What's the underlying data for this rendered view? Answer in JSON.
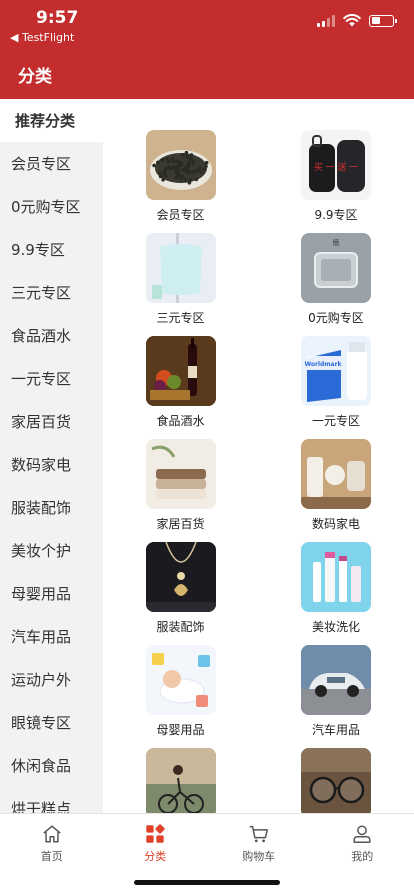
{
  "status": {
    "time": "9:57",
    "back_app": "◀ TestFlight"
  },
  "header": {
    "title": "分类"
  },
  "sidebar": {
    "items": [
      {
        "label": "推荐分类",
        "active": true
      },
      {
        "label": "会员专区"
      },
      {
        "label": "0元购专区"
      },
      {
        "label": "9.9专区"
      },
      {
        "label": "三元专区"
      },
      {
        "label": "食品酒水"
      },
      {
        "label": "一元专区"
      },
      {
        "label": "家居百货"
      },
      {
        "label": "数码家电"
      },
      {
        "label": "服装配饰"
      },
      {
        "label": "美妆个护"
      },
      {
        "label": "母婴用品"
      },
      {
        "label": "汽车用品"
      },
      {
        "label": "运动户外"
      },
      {
        "label": "眼镜专区"
      },
      {
        "label": "休闲食品"
      },
      {
        "label": "烘干糕点"
      }
    ]
  },
  "categories": [
    {
      "label": "会员专区",
      "image": "tea-leaves"
    },
    {
      "label": "9.9专区",
      "image": "backpack-promo",
      "promo_text": "买 一 送 一"
    },
    {
      "label": "三元专区",
      "image": "towel"
    },
    {
      "label": "0元购专区",
      "image": "glass-ashtray"
    },
    {
      "label": "食品酒水",
      "image": "wine-fruit"
    },
    {
      "label": "一元专区",
      "image": "milk-box",
      "brand_text": "Worldmark"
    },
    {
      "label": "家居百货",
      "image": "folded-towels"
    },
    {
      "label": "数码家电",
      "image": "home-appliances"
    },
    {
      "label": "服装配饰",
      "image": "necklace"
    },
    {
      "label": "美妆洗化",
      "image": "cosmetics"
    },
    {
      "label": "母婴用品",
      "image": "baby"
    },
    {
      "label": "汽车用品",
      "image": "car"
    },
    {
      "label": "",
      "image": "cyclist"
    },
    {
      "label": "",
      "image": "eyeglasses"
    }
  ],
  "tabs": [
    {
      "label": "首页",
      "icon": "home-icon"
    },
    {
      "label": "分类",
      "icon": "category-icon",
      "active": true
    },
    {
      "label": "购物车",
      "icon": "cart-icon"
    },
    {
      "label": "我的",
      "icon": "profile-icon"
    }
  ],
  "colors": {
    "brand": "#c32d2d",
    "accent": "#e0412b",
    "sidebar_bg": "#f2f2f4"
  }
}
